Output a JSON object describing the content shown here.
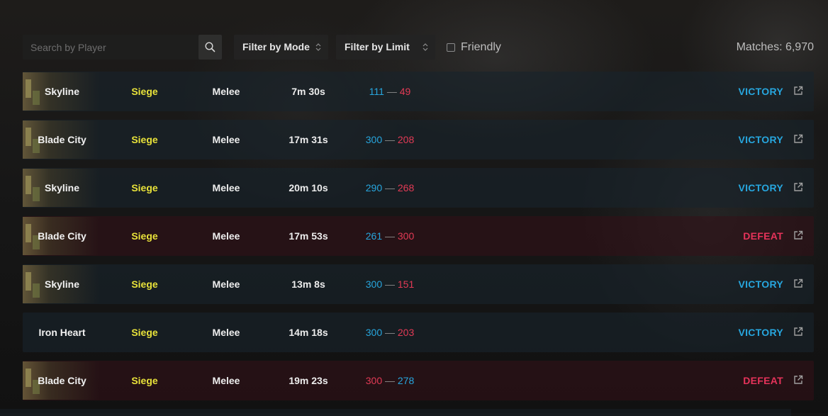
{
  "toolbar": {
    "search_placeholder": "Search by Player",
    "filter_mode": "Filter by Mode",
    "filter_limit": "Filter by Limit",
    "friendly_label": "Friendly",
    "matches": "Matches: 6,970"
  },
  "colors": {
    "victory": "#27a6de",
    "defeat": "#e6335a",
    "mode": "#e8e23a"
  },
  "matches": [
    {
      "map": "Skyline",
      "mode": "Siege",
      "type": "Melee",
      "duration": "7m 30s",
      "score_a": "111",
      "score_b": "49",
      "result": "VICTORY"
    },
    {
      "map": "Blade City",
      "mode": "Siege",
      "type": "Melee",
      "duration": "17m 31s",
      "score_a": "300",
      "score_b": "208",
      "result": "VICTORY"
    },
    {
      "map": "Skyline",
      "mode": "Siege",
      "type": "Melee",
      "duration": "20m 10s",
      "score_a": "290",
      "score_b": "268",
      "result": "VICTORY"
    },
    {
      "map": "Blade City",
      "mode": "Siege",
      "type": "Melee",
      "duration": "17m 53s",
      "score_a": "261",
      "score_b": "300",
      "result": "DEFEAT"
    },
    {
      "map": "Skyline",
      "mode": "Siege",
      "type": "Melee",
      "duration": "13m 8s",
      "score_a": "300",
      "score_b": "151",
      "result": "VICTORY"
    },
    {
      "map": "Iron Heart",
      "mode": "Siege",
      "type": "Melee",
      "duration": "14m 18s",
      "score_a": "300",
      "score_b": "203",
      "result": "VICTORY"
    },
    {
      "map": "Blade City",
      "mode": "Siege",
      "type": "Melee",
      "duration": "19m 23s",
      "score_a": "300",
      "score_b": "278",
      "result": "DEFEAT"
    }
  ]
}
